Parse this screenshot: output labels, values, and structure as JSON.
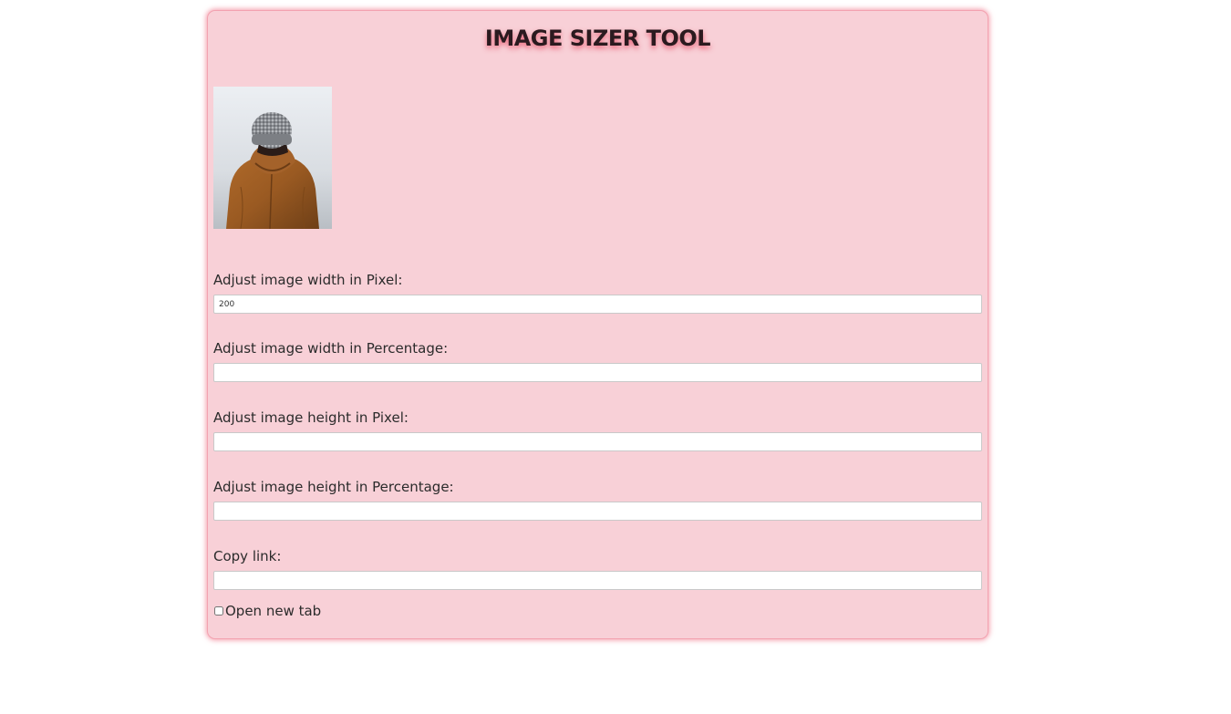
{
  "app": {
    "title": "IMAGE SIZER TOOL",
    "accent_color": "#f8d0d7",
    "shadow_color": "#e85a70"
  },
  "image": {
    "subject": "person-in-beanie-and-brown-hooded-jacket-photo"
  },
  "fields": [
    {
      "label": "Adjust image width in Pixel:",
      "value": "200",
      "placeholder": ""
    },
    {
      "label": "Adjust image width in Percentage:",
      "value": "",
      "placeholder": ""
    },
    {
      "label": "Adjust image height in Pixel:",
      "value": "",
      "placeholder": ""
    },
    {
      "label": "Adjust image height in Percentage:",
      "value": "",
      "placeholder": ""
    },
    {
      "label": "Copy link:",
      "value": "",
      "placeholder": ""
    }
  ],
  "checkbox": {
    "label": "Open new tab",
    "checked": false
  }
}
